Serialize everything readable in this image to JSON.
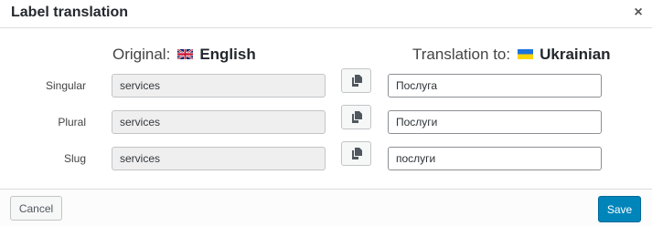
{
  "dialog": {
    "title": "Label translation",
    "close_label": "×"
  },
  "original": {
    "prefix": "Original:",
    "language": "English",
    "flag_icon": "uk-flag-icon"
  },
  "translation": {
    "prefix": "Translation to:",
    "language": "Ukrainian",
    "flag_icon": "ukraine-flag-icon"
  },
  "rows": [
    {
      "label": "Singular",
      "original": "services",
      "translation": "Послуга"
    },
    {
      "label": "Plural",
      "original": "services",
      "translation": "Послуги"
    },
    {
      "label": "Slug",
      "original": "services",
      "translation": "послуги"
    }
  ],
  "footer": {
    "cancel_label": "Cancel",
    "save_label": "Save"
  },
  "colors": {
    "primary": "#0085ba",
    "readonly_bg": "#efefef"
  }
}
